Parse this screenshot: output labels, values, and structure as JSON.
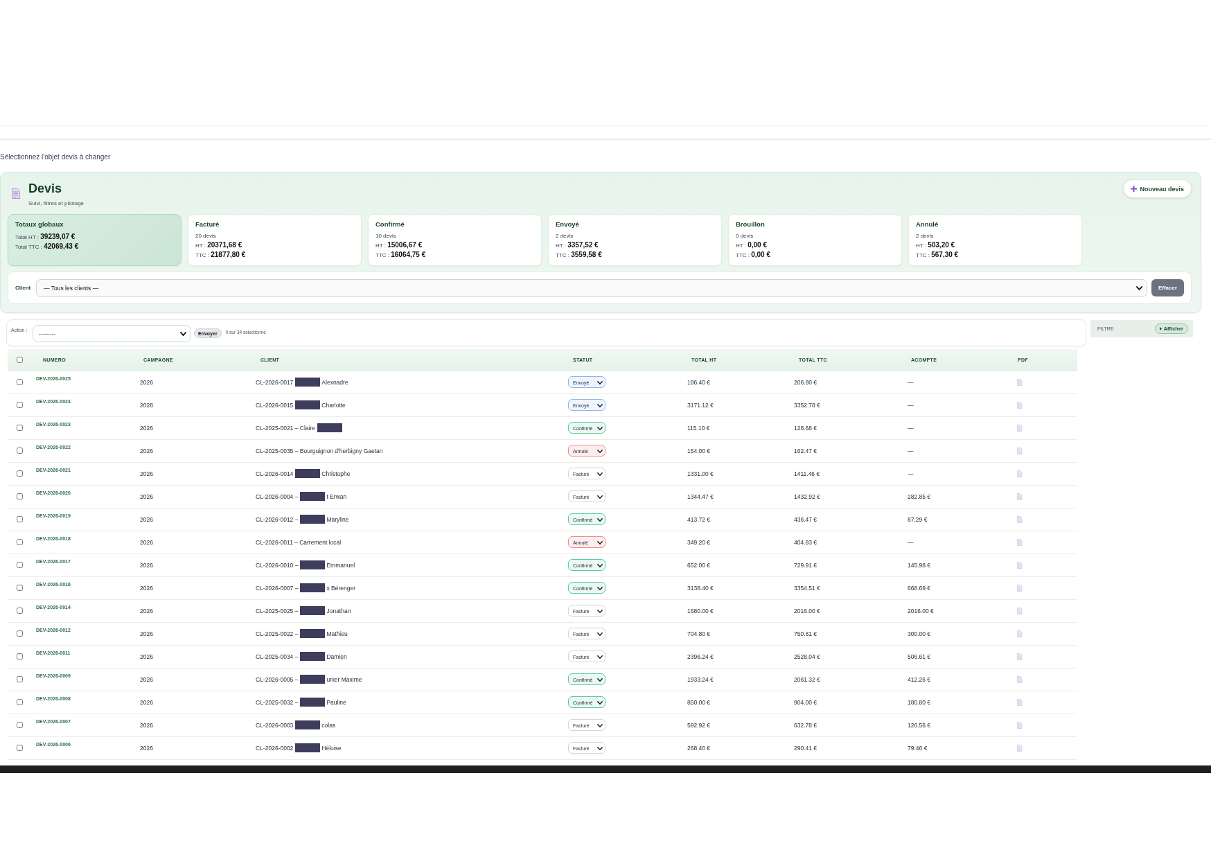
{
  "page_title": "Sélectionnez l'objet devis à changer",
  "header": {
    "title": "Devis",
    "subtitle": "Suivi, filtres et pilotage",
    "new_button": "Nouveau devis"
  },
  "summary_cards": [
    {
      "kind": "totals",
      "title": "Totaux globaux",
      "lines": [
        "Total HT : **39239,07 €**",
        "Total TTC : **42069,43 €**"
      ]
    },
    {
      "kind": "status",
      "title": "Facturé",
      "count": "20 devis",
      "lines": [
        "HT : **20371,68 €**",
        "TTC : **21877,80 €**"
      ]
    },
    {
      "kind": "status",
      "title": "Confirmé",
      "count": "10 devis",
      "lines": [
        "HT : **15006,67 €**",
        "TTC : **16064,75 €**"
      ]
    },
    {
      "kind": "status",
      "title": "Envoyé",
      "count": "2 devis",
      "lines": [
        "HT : **3357,52 €**",
        "TTC : **3559,58 €**"
      ]
    },
    {
      "kind": "status",
      "title": "Brouillon",
      "count": "0 devis",
      "lines": [
        "HT : **0,00 €**",
        "TTC : **0,00 €**"
      ]
    },
    {
      "kind": "status",
      "title": "Annulé",
      "count": "2 devis",
      "lines": [
        "HT : **503,20 €**",
        "TTC : **567,30 €**"
      ]
    }
  ],
  "client_filter": {
    "label": "Client",
    "value": "— Tous les clients —",
    "clear_button": "Effacer"
  },
  "actions": {
    "label": "Action :",
    "value": "---------",
    "submit_button": "Envoyer",
    "selection_count": "0 sur 34 sélectionné"
  },
  "filter_panel": {
    "title": "FILTRE",
    "toggle_button": "Afficher",
    "expanded": false
  },
  "table": {
    "select_all": {
      "checked": false
    },
    "columns": [
      "NUMERO",
      "CAMPAGNE",
      "CLIENT",
      "STATUT",
      "TOTAL HT",
      "TOTAL TTC",
      "ACOMPTE",
      "PDF"
    ],
    "rows": [
      {
        "checked": false,
        "numero": "DEV-2026-0025",
        "campagne": "2026",
        "client": [
          {
            "kind": "text",
            "text": "CL-2026-0017"
          },
          {
            "kind": "redaction"
          },
          {
            "kind": "text",
            "text": "Alexnadre"
          }
        ],
        "status": {
          "value": "Envoyé",
          "kind": "sent"
        },
        "total_ht": "186.40 €",
        "total_ttc": "206.80 €",
        "acompte": "—"
      },
      {
        "checked": false,
        "numero": "DEV-2026-0024",
        "campagne": "2028",
        "client": [
          {
            "kind": "text",
            "text": "CL-2026-0015"
          },
          {
            "kind": "redaction"
          },
          {
            "kind": "text",
            "text": "Charlotte"
          }
        ],
        "status": {
          "value": "Envoyé",
          "kind": "sent"
        },
        "total_ht": "3171.12 €",
        "total_ttc": "3352.78 €",
        "acompte": "—"
      },
      {
        "checked": false,
        "numero": "DEV-2026-0023",
        "campagne": "2026",
        "client": [
          {
            "kind": "text",
            "text": "CL-2025-0021 – Claire"
          },
          {
            "kind": "redaction"
          }
        ],
        "status": {
          "value": "Confirmé",
          "kind": "confirmed"
        },
        "total_ht": "115.10 €",
        "total_ttc": "128.68 €",
        "acompte": "—"
      },
      {
        "checked": false,
        "numero": "DEV-2026-0022",
        "campagne": "2026",
        "client": [
          {
            "kind": "text",
            "text": "CL-2025-0035 – Bourguignon d'herbigny Gaetan"
          }
        ],
        "status": {
          "value": "Annulé",
          "kind": "cancelled"
        },
        "total_ht": "154.00 €",
        "total_ttc": "162.47 €",
        "acompte": "—"
      },
      {
        "checked": false,
        "numero": "DEV-2026-0021",
        "campagne": "2026",
        "client": [
          {
            "kind": "text",
            "text": "CL-2026-0014"
          },
          {
            "kind": "redaction"
          },
          {
            "kind": "text",
            "text": "Christophe"
          }
        ],
        "status": {
          "value": "Facturé",
          "kind": "invoiced"
        },
        "total_ht": "1331.00 €",
        "total_ttc": "1411.46 €",
        "acompte": "—"
      },
      {
        "checked": false,
        "numero": "DEV-2026-0020",
        "campagne": "2026",
        "client": [
          {
            "kind": "text",
            "text": "CL-2026-0004 –"
          },
          {
            "kind": "redaction"
          },
          {
            "kind": "text",
            "text": "t Erwan"
          }
        ],
        "status": {
          "value": "Facturé",
          "kind": "invoiced"
        },
        "total_ht": "1344.47 €",
        "total_ttc": "1432.92 €",
        "acompte": "282.85 €"
      },
      {
        "checked": false,
        "numero": "DEV-2026-0019",
        "campagne": "2026",
        "client": [
          {
            "kind": "text",
            "text": "CL-2026-0012 –"
          },
          {
            "kind": "redaction"
          },
          {
            "kind": "text",
            "text": "Maryline"
          }
        ],
        "status": {
          "value": "Confirmé",
          "kind": "confirmed"
        },
        "total_ht": "413.72 €",
        "total_ttc": "436.47 €",
        "acompte": "87.29 €"
      },
      {
        "checked": false,
        "numero": "DEV-2026-0018",
        "campagne": "2026",
        "client": [
          {
            "kind": "text",
            "text": "CL-2026-0011 – Carrement local"
          }
        ],
        "status": {
          "value": "Annulé",
          "kind": "cancelled"
        },
        "total_ht": "349.20 €",
        "total_ttc": "404.83 €",
        "acompte": "—"
      },
      {
        "checked": false,
        "numero": "DEV-2026-0017",
        "campagne": "2026",
        "client": [
          {
            "kind": "text",
            "text": "CL-2026-0010 –"
          },
          {
            "kind": "redaction"
          },
          {
            "kind": "text",
            "text": "Emmanuel"
          }
        ],
        "status": {
          "value": "Confirmé",
          "kind": "confirmed"
        },
        "total_ht": "652.00 €",
        "total_ttc": "729.91 €",
        "acompte": "145.98 €"
      },
      {
        "checked": false,
        "numero": "DEV-2026-0016",
        "campagne": "2026",
        "client": [
          {
            "kind": "text",
            "text": "CL-2026-0007 –"
          },
          {
            "kind": "redaction"
          },
          {
            "kind": "text",
            "text": "x Bérenger"
          }
        ],
        "status": {
          "value": "Confirmé",
          "kind": "confirmed"
        },
        "total_ht": "3138.40 €",
        "total_ttc": "3354.51 €",
        "acompte": "668.69 €"
      },
      {
        "checked": false,
        "numero": "DEV-2026-0014",
        "campagne": "2026",
        "client": [
          {
            "kind": "text",
            "text": "CL-2025-0025 –"
          },
          {
            "kind": "redaction"
          },
          {
            "kind": "text",
            "text": "Jonathan"
          }
        ],
        "status": {
          "value": "Facturé",
          "kind": "invoiced"
        },
        "total_ht": "1680.00 €",
        "total_ttc": "2016.00 €",
        "acompte": "2016.00 €"
      },
      {
        "checked": false,
        "numero": "DEV-2026-0012",
        "campagne": "2026",
        "client": [
          {
            "kind": "text",
            "text": "CL-2025-0022 –"
          },
          {
            "kind": "redaction"
          },
          {
            "kind": "text",
            "text": "Mathieu"
          }
        ],
        "status": {
          "value": "Facturé",
          "kind": "invoiced"
        },
        "total_ht": "704.80 €",
        "total_ttc": "750.81 €",
        "acompte": "300.00 €"
      },
      {
        "checked": false,
        "numero": "DEV-2026-0011",
        "campagne": "2026",
        "client": [
          {
            "kind": "text",
            "text": "CL-2025-0034 –"
          },
          {
            "kind": "redaction"
          },
          {
            "kind": "text",
            "text": "Damien"
          }
        ],
        "status": {
          "value": "Facturé",
          "kind": "invoiced"
        },
        "total_ht": "2396.24 €",
        "total_ttc": "2528.04 €",
        "acompte": "506.61 €"
      },
      {
        "checked": false,
        "numero": "DEV-2026-0009",
        "campagne": "2026",
        "client": [
          {
            "kind": "text",
            "text": "CL-2026-0005 –"
          },
          {
            "kind": "redaction"
          },
          {
            "kind": "text",
            "text": "unier Maxime"
          }
        ],
        "status": {
          "value": "Confirmé",
          "kind": "confirmed"
        },
        "total_ht": "1933.24 €",
        "total_ttc": "2061.32 €",
        "acompte": "412.26 €"
      },
      {
        "checked": false,
        "numero": "DEV-2026-0008",
        "campagne": "2026",
        "client": [
          {
            "kind": "text",
            "text": "CL-2025-0032 –"
          },
          {
            "kind": "redaction"
          },
          {
            "kind": "text",
            "text": "Pauline"
          }
        ],
        "status": {
          "value": "Confirmé",
          "kind": "confirmed"
        },
        "total_ht": "850.00 €",
        "total_ttc": "904.00 €",
        "acompte": "180.80 €"
      },
      {
        "checked": false,
        "numero": "DEV-2026-0007",
        "campagne": "2026",
        "client": [
          {
            "kind": "text",
            "text": "CL-2026-0003"
          },
          {
            "kind": "redaction"
          },
          {
            "kind": "text",
            "text": "colas"
          }
        ],
        "status": {
          "value": "Facturé",
          "kind": "invoiced"
        },
        "total_ht": "592.92 €",
        "total_ttc": "632.78 €",
        "acompte": "126.56 €"
      },
      {
        "checked": false,
        "numero": "DEV-2026-0006",
        "campagne": "2026",
        "client": [
          {
            "kind": "text",
            "text": "CL-2026-0002"
          },
          {
            "kind": "redaction"
          },
          {
            "kind": "text",
            "text": "Héloise"
          }
        ],
        "status": {
          "value": "Facturé",
          "kind": "invoiced"
        },
        "total_ht": "268.40 €",
        "total_ttc": "290.41 €",
        "acompte": "79.46 €"
      }
    ]
  }
}
